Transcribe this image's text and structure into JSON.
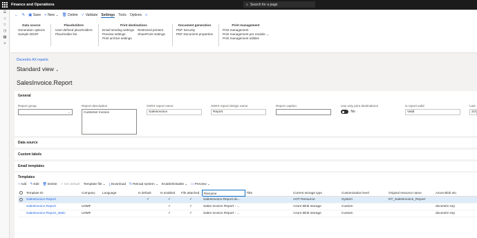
{
  "topbar": {
    "title": "Finance and Operations",
    "search_placeholder": "Search for a page"
  },
  "actionbar": {
    "save": "Save",
    "new": "New",
    "delete": "Delete",
    "validate": "Validate",
    "settings": "Settings",
    "tools": "Tools",
    "options": "Options"
  },
  "ribbon": {
    "data_source": {
      "title": "Data source",
      "items": [
        "Generation options",
        "Sample DDSP"
      ]
    },
    "placeholders": {
      "title": "Placeholders",
      "items": [
        "User-defined placeholders",
        "Placeholder list"
      ]
    },
    "print_destinations": {
      "title": "Print destinations",
      "col1": [
        "Email sending settings",
        "Preview settings",
        "Print archive settings"
      ],
      "col2": [
        "Restricted printers",
        "SharePoint settings"
      ]
    },
    "document_generation": {
      "title": "Document generation",
      "items": [
        "PDF Security",
        "PDF Document properties"
      ]
    },
    "print_management": {
      "title": "Print management",
      "items": [
        "Print management",
        "Print management per module",
        "Print management utilities"
      ]
    }
  },
  "breadcrumb": "Docentric AX reports",
  "view_title": "Standard view",
  "page_title": "SalesInvoice.Report",
  "general": {
    "title": "General",
    "report_group": {
      "label": "Report group",
      "value": ""
    },
    "report_description": {
      "label": "Report description",
      "value": "Customer invoice"
    },
    "ssrs_report_name": {
      "label": "SSRS report name",
      "value": "SalesInvoice"
    },
    "ssrs_design_name": {
      "label": "SSRS report design name",
      "value": "Report"
    },
    "report_caption": {
      "label": "Report caption",
      "value": ""
    },
    "use_only_print": {
      "label": "Use only print destinations",
      "value": "No"
    },
    "report_valid": {
      "label": "Is report valid",
      "value": "Valid"
    },
    "last": {
      "label": "Last",
      "value": "2/2"
    }
  },
  "fasttabs": [
    "Data source",
    "Custom labels",
    "Email templates"
  ],
  "templates": {
    "title": "Templates",
    "toolbar": [
      "Add",
      "Edit",
      "Delete",
      "Set default",
      "Template file",
      "Download",
      "Reload system",
      "Enable/Disable",
      "Preview"
    ],
    "columns": [
      "Template ID",
      "Company",
      "Language",
      "Is default",
      "Is enabled",
      "File attached",
      "Filename",
      "Title",
      "Current storage type",
      "Customization level",
      "Original resource name",
      "Azure Blob sto"
    ],
    "rows": [
      {
        "id": "SalesInvoice.Report",
        "company": "",
        "language": "",
        "is_default": "✓",
        "is_enabled": "✓",
        "file_attached": "✓",
        "filename": "SalesInvoice.Report.do...",
        "title": "",
        "storage": "AOT Resource",
        "level": "System",
        "resource": "DT_SalesInvoice_Report",
        "azure": ""
      },
      {
        "id": "SalesInvoice.Report",
        "company": "USMF",
        "language": "",
        "is_default": "",
        "is_enabled": "✓",
        "file_attached": "✓",
        "filename": "Sales Invoice Report - ...",
        "title": "",
        "storage": "Azure Blob storage",
        "level": "Custom",
        "resource": "",
        "azure": "docentric-rep"
      },
      {
        "id": "SalesInvoice.Report_static",
        "company": "USMF",
        "language": "",
        "is_default": "",
        "is_enabled": "✓",
        "file_attached": "✓",
        "filename": "Sales Invoice Report - ...",
        "title": "",
        "storage": "Azure Blob storage",
        "level": "Custom",
        "resource": "",
        "azure": "docentric-rep"
      }
    ]
  }
}
